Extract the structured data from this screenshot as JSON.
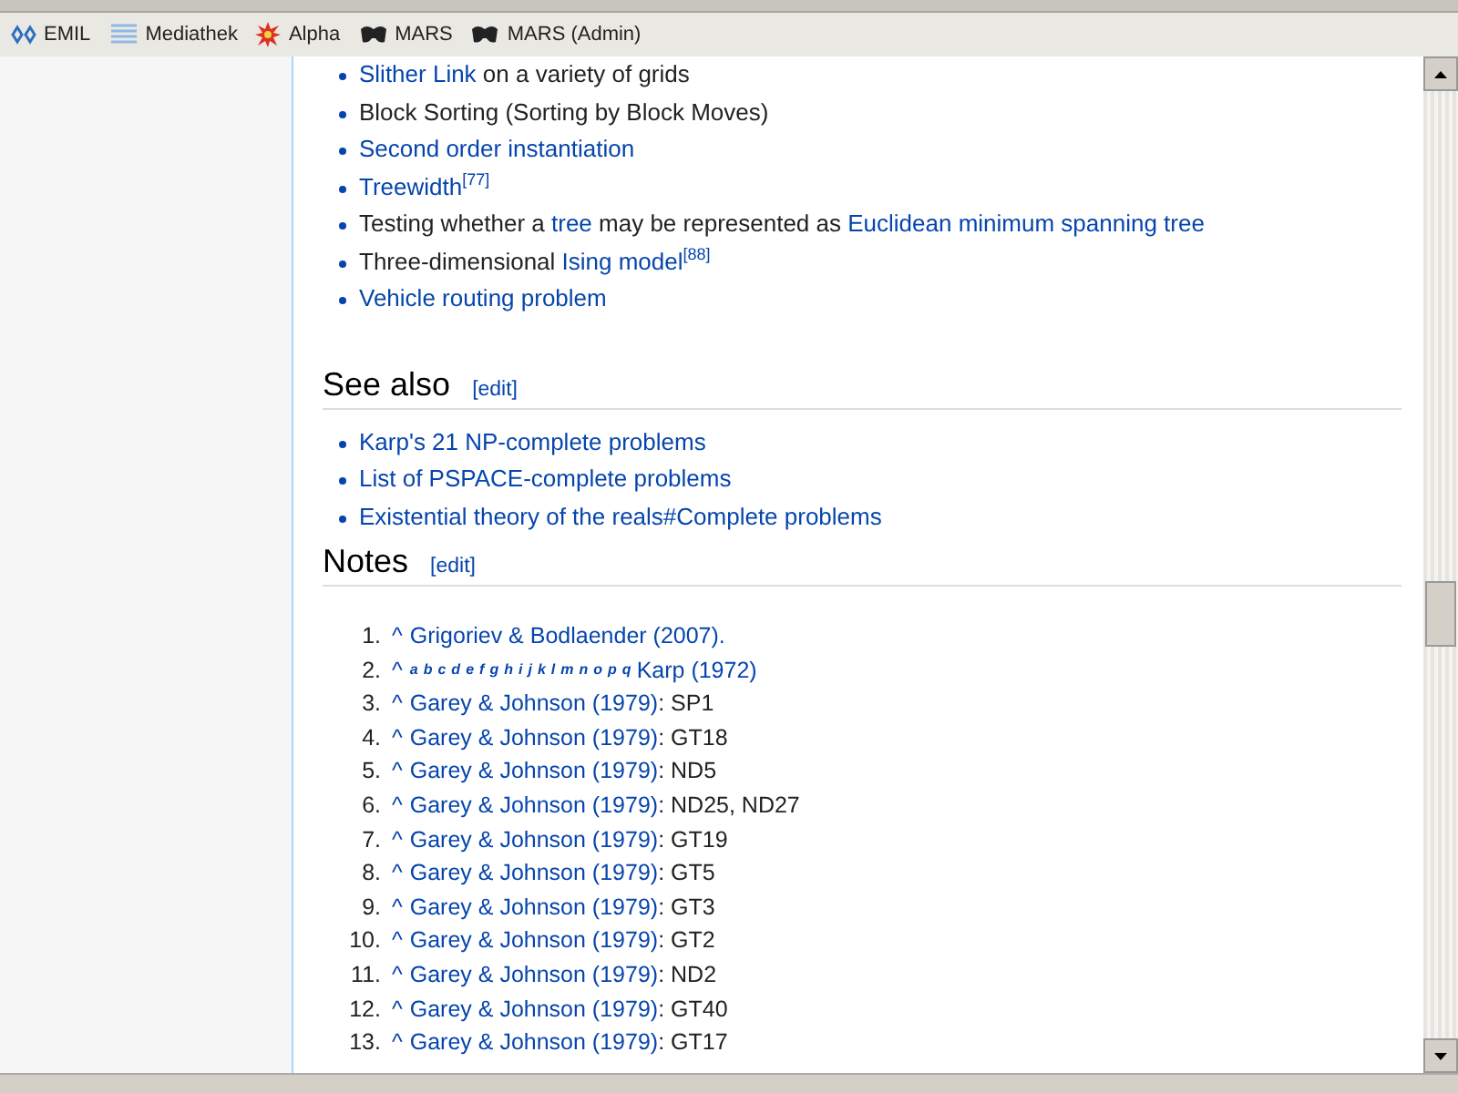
{
  "bookmarks": [
    {
      "label": "EMIL"
    },
    {
      "label": "Mediathek"
    },
    {
      "label": "Alpha"
    },
    {
      "label": "MARS"
    },
    {
      "label": "MARS (Admin)"
    }
  ],
  "problems": [
    [
      {
        "kind": "link",
        "text": "Slither Link"
      },
      {
        "kind": "text",
        "text": " on a variety of grids"
      }
    ],
    [
      {
        "kind": "text",
        "text": "Block Sorting (Sorting by Block Moves)"
      }
    ],
    [
      {
        "kind": "link",
        "text": "Second order instantiation"
      }
    ],
    [
      {
        "kind": "link",
        "text": "Treewidth"
      },
      {
        "kind": "ref",
        "text": "[77]"
      }
    ],
    [
      {
        "kind": "text",
        "text": "Testing whether a "
      },
      {
        "kind": "link",
        "text": "tree"
      },
      {
        "kind": "text",
        "text": " may be represented as "
      },
      {
        "kind": "link",
        "text": "Euclidean minimum spanning tree"
      }
    ],
    [
      {
        "kind": "text",
        "text": "Three-dimensional "
      },
      {
        "kind": "link",
        "text": "Ising model"
      },
      {
        "kind": "ref",
        "text": "[88]"
      }
    ],
    [
      {
        "kind": "link",
        "text": "Vehicle routing problem"
      }
    ]
  ],
  "see_also": {
    "heading": "See also",
    "edit": "[edit]",
    "items": [
      "Karp's 21 NP-complete problems",
      "List of PSPACE-complete problems",
      "Existential theory of the reals#Complete problems"
    ]
  },
  "notes": {
    "heading": "Notes",
    "edit": "[edit]",
    "items": [
      {
        "number": "1.",
        "caret": "^",
        "source": "Grigoriev & Bodlaender (2007)."
      },
      {
        "number": "2.",
        "caret": "^",
        "backlinks": [
          "a",
          "b",
          "c",
          "d",
          "e",
          "f",
          "g",
          "h",
          "i",
          "j",
          "k",
          "l",
          "m",
          "n",
          "o",
          "p",
          "q"
        ],
        "source": "Karp (1972)"
      },
      {
        "number": "3.",
        "caret": "^",
        "source": "Garey & Johnson (1979)",
        "detail": ": SP1"
      },
      {
        "number": "4.",
        "caret": "^",
        "source": "Garey & Johnson (1979)",
        "detail": ": GT18"
      },
      {
        "number": "5.",
        "caret": "^",
        "source": "Garey & Johnson (1979)",
        "detail": ": ND5"
      },
      {
        "number": "6.",
        "caret": "^",
        "source": "Garey & Johnson (1979)",
        "detail": ": ND25, ND27"
      },
      {
        "number": "7.",
        "caret": "^",
        "source": "Garey & Johnson (1979)",
        "detail": ": GT19"
      },
      {
        "number": "8.",
        "caret": "^",
        "source": "Garey & Johnson (1979)",
        "detail": ": GT5"
      },
      {
        "number": "9.",
        "caret": "^",
        "source": "Garey & Johnson (1979)",
        "detail": ": GT3"
      },
      {
        "number": "10.",
        "caret": "^",
        "source": "Garey & Johnson (1979)",
        "detail": ": GT2"
      },
      {
        "number": "11.",
        "caret": "^",
        "source": "Garey & Johnson (1979)",
        "detail": ": ND2"
      },
      {
        "number": "12.",
        "caret": "^",
        "source": "Garey & Johnson (1979)",
        "detail": ": GT40"
      },
      {
        "number": "13.",
        "caret": "^",
        "source": "Garey & Johnson (1979)",
        "detail": ": GT17"
      }
    ]
  }
}
